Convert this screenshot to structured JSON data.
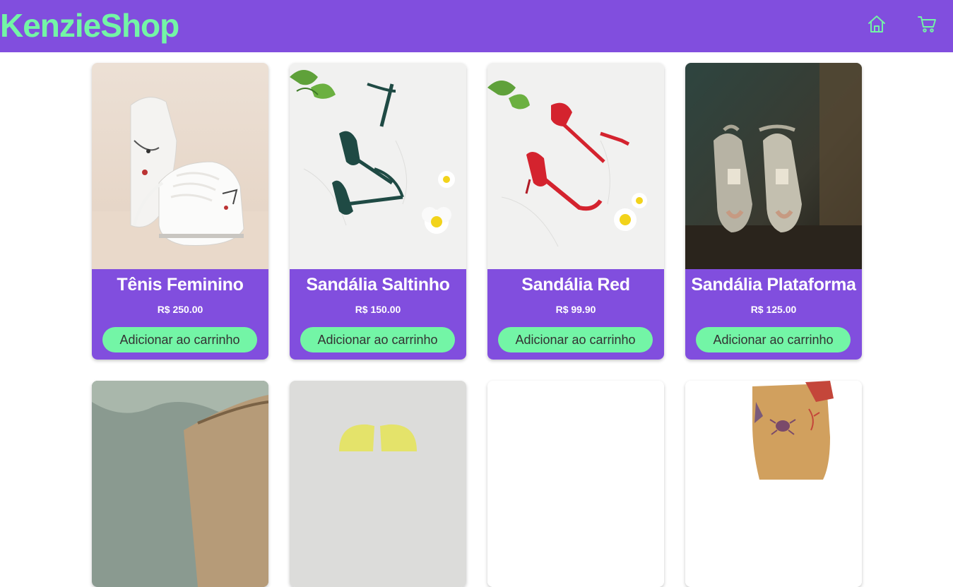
{
  "header": {
    "logo": "KenzieShop",
    "home_icon": "home-icon",
    "cart_icon": "cart-icon",
    "colors": {
      "primary": "#814ede",
      "accent": "#73f5a6"
    }
  },
  "products": [
    {
      "title": "Tênis Feminino",
      "price": "R$ 250.00",
      "button_label": "Adicionar ao carrinho"
    },
    {
      "title": "Sandália Saltinho",
      "price": "R$ 150.00",
      "button_label": "Adicionar ao carrinho"
    },
    {
      "title": "Sandália Red",
      "price": "R$ 99.90",
      "button_label": "Adicionar ao carrinho"
    },
    {
      "title": "Sandália Plataforma",
      "price": "R$ 125.00",
      "button_label": "Adicionar ao carrinho"
    }
  ]
}
